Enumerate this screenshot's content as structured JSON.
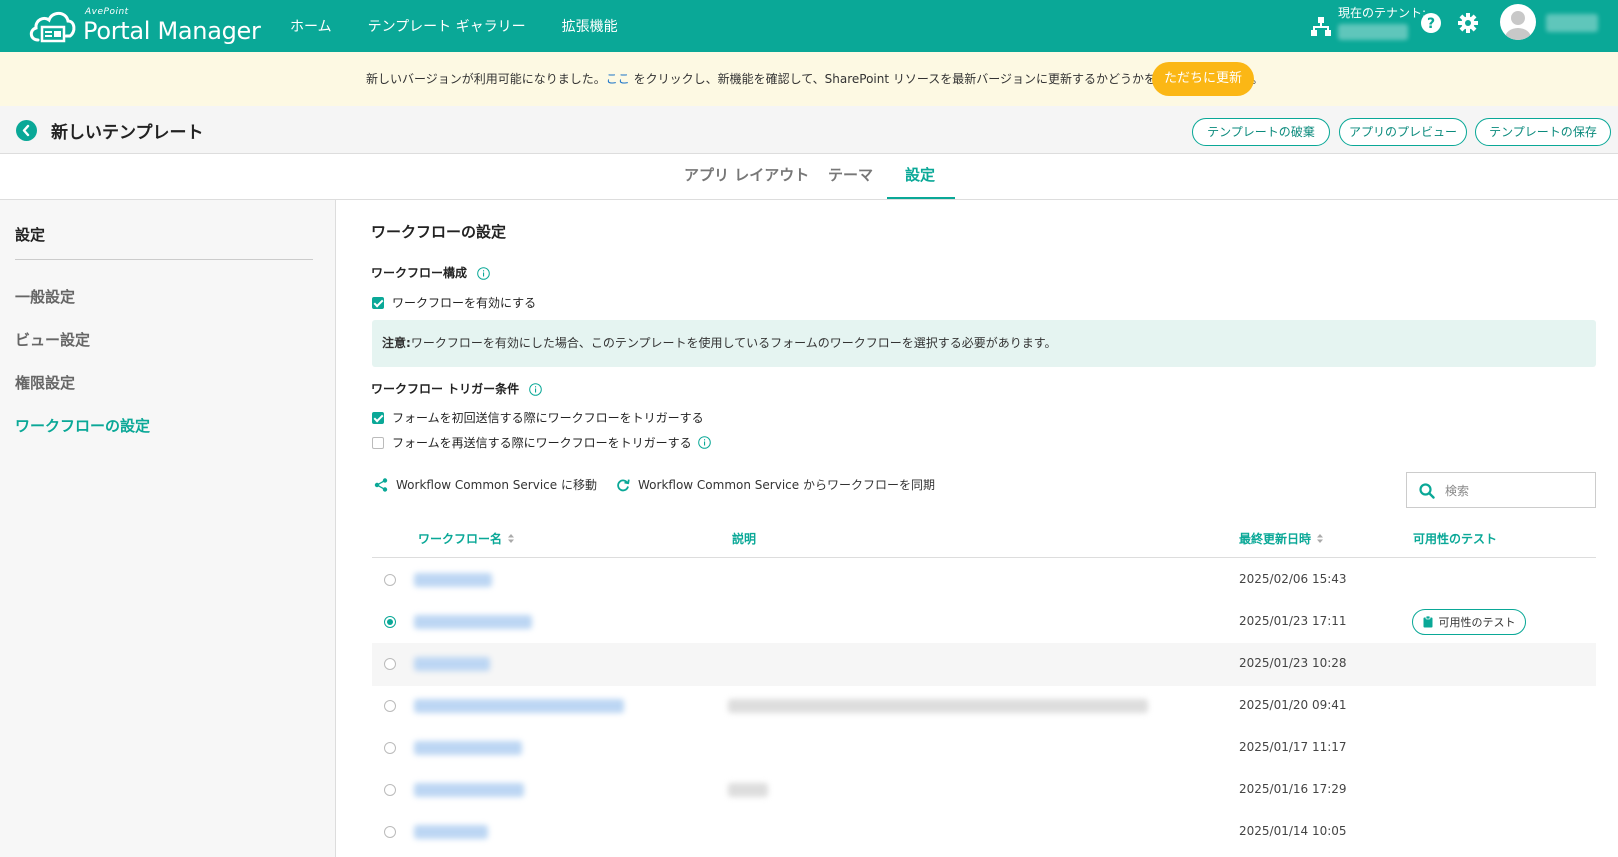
{
  "app": {
    "brand_small": "AvePoint",
    "brand": "Portal Manager"
  },
  "nav": [
    {
      "label": "ホーム"
    },
    {
      "label": "テンプレート ギャラリー"
    },
    {
      "label": "拡張機能"
    }
  ],
  "header": {
    "tenant_label": "現在のテナント:"
  },
  "banner": {
    "text_before": "新しいバージョンが利用可能になりました。",
    "link": "ここ",
    "text_after": " をクリックし、新機能を確認して、SharePoint リソースを最新バージョンに更新するかどうかを決定してください。",
    "button": "ただちに更新"
  },
  "page": {
    "title": "新しいテンプレート",
    "actions": {
      "discard": "テンプレートの破棄",
      "preview": "アプリのプレビュー",
      "save": "テンプレートの保存"
    }
  },
  "tabs": [
    {
      "label": "アプリ レイアウト"
    },
    {
      "label": "テーマ"
    },
    {
      "label": "設定"
    }
  ],
  "sidebar": {
    "heading": "設定",
    "items": [
      {
        "label": "一般設定"
      },
      {
        "label": "ビュー設定"
      },
      {
        "label": "権限設定"
      },
      {
        "label": "ワークフローの設定"
      }
    ]
  },
  "main": {
    "title": "ワークフローの設定",
    "config_title": "ワークフロー構成",
    "enable_label": "ワークフローを有効にする",
    "note_bold": "注意:",
    "note_text": "ワークフローを有効にした場合、このテンプレートを使用しているフォームのワークフローを選択する必要があります。",
    "trigger_title": "ワークフロー トリガー条件",
    "trigger_first": "フォームを初回送信する際にワークフローをトリガーする",
    "trigger_resubmit": "フォームを再送信する際にワークフローをトリガーする",
    "action_move": "Workflow Common Service に移動",
    "action_sync": "Workflow Common Service からワークフローを同期",
    "search_placeholder": "検索"
  },
  "table": {
    "columns": {
      "name": "ワークフロー名",
      "description": "説明",
      "modified": "最終更新日時",
      "test": "可用性のテスト"
    },
    "test_button": "可用性のテスト",
    "rows": [
      {
        "date": "2025/02/06 15:43"
      },
      {
        "date": "2025/01/23 17:11"
      },
      {
        "date": "2025/01/23 10:28"
      },
      {
        "date": "2025/01/20 09:41"
      },
      {
        "date": "2025/01/17 11:17"
      },
      {
        "date": "2025/01/16 17:29"
      },
      {
        "date": "2025/01/14 10:05"
      }
    ]
  },
  "colors": {
    "accent": "#0aa897",
    "banner_bg": "#fdf9e3",
    "update_button": "#fbb715",
    "note_bg": "#e5f4f1"
  }
}
